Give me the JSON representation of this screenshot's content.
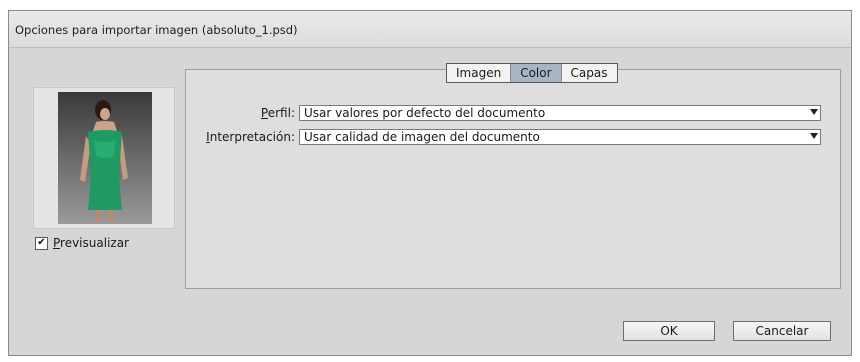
{
  "window": {
    "title": "Opciones para importar imagen (absoluto_1.psd)"
  },
  "preview": {
    "checkbox_label_underlined": "P",
    "checkbox_label_rest": "revisualizar",
    "checked": true
  },
  "tabs": [
    {
      "label": "Imagen",
      "active": false
    },
    {
      "label": "Color",
      "active": true
    },
    {
      "label": "Capas",
      "active": false
    }
  ],
  "form": {
    "perfil": {
      "label_underlined": "P",
      "label_rest": "erfil:",
      "value": "Usar valores por defecto del documento"
    },
    "interpretacion": {
      "label_underlined": "I",
      "label_rest": "nterpretación:",
      "value": "Usar calidad de imagen del documento"
    }
  },
  "buttons": {
    "ok": "OK",
    "cancel": "Cancelar"
  },
  "colors": {
    "dialog_bg": "#d6d6d6",
    "active_tab": "#a8b4c4",
    "dress_green": "#1f9a62"
  }
}
